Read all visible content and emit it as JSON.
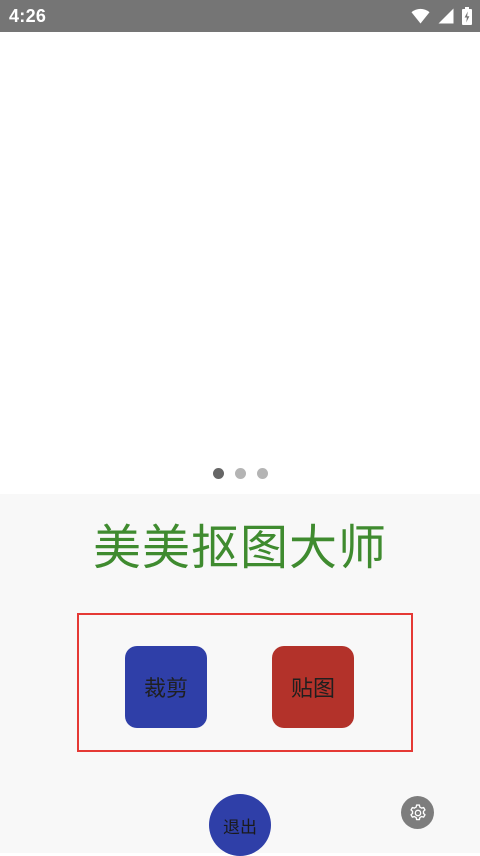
{
  "status_bar": {
    "time": "4:26",
    "icons": [
      "wifi-icon",
      "cell-signal-icon",
      "battery-charging-icon"
    ]
  },
  "banner": {
    "page_indicator": {
      "count": 3,
      "active_index": 0
    }
  },
  "app_title": "美美抠图大师",
  "actions": {
    "crop_label": "裁剪",
    "sticker_label": "贴图"
  },
  "exit_label": "退出",
  "settings_icon": "gear-icon",
  "colors": {
    "status_bar": "#757575",
    "title_green": "#3f8b2f",
    "crop_blue": "#2f3fa8",
    "sticker_red": "#b3322a",
    "exit_blue": "#2f3fa8",
    "frame_red": "#e53935",
    "panel_bg": "#f8f8f8"
  }
}
